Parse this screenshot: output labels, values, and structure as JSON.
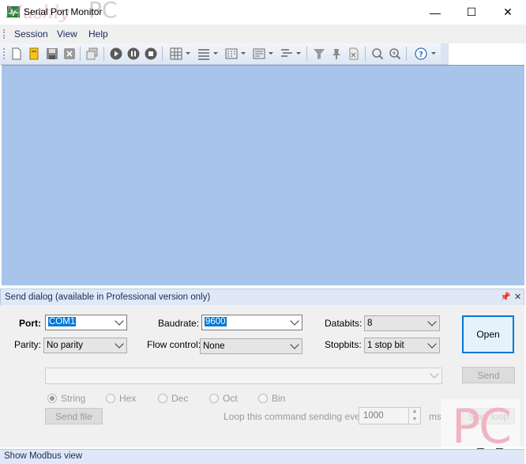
{
  "window": {
    "title": "Serial Port Monitor",
    "controls": {
      "minimize": "—",
      "maximize": "☐",
      "close": "✕"
    }
  },
  "watermark": {
    "script": "Mushly",
    "text": "PC"
  },
  "menu": [
    {
      "label": "Session"
    },
    {
      "label": "View"
    },
    {
      "label": "Help"
    }
  ],
  "toolbar": {
    "icons": [
      "new-session-icon",
      "open-icon",
      "save-icon",
      "close-session-icon",
      "copy-icon",
      "start-icon",
      "pause-icon",
      "stop-icon",
      "grid-view-icon",
      "list-view-icon",
      "dump-view-icon",
      "terminal-view-icon",
      "line-view-icon",
      "filter-icon",
      "pin-icon",
      "clear-icon",
      "find-icon",
      "find-next-icon",
      "help-icon"
    ]
  },
  "send_dialog": {
    "title": "Send dialog (available in Professional version only)",
    "pin_glyph": "📌",
    "close_glyph": "✕",
    "port_label": "Port:",
    "port_value": "COM1",
    "baudrate_label": "Baudrate:",
    "baudrate_value": "9600",
    "databits_label": "Databits:",
    "databits_value": "8",
    "parity_label": "Parity:",
    "parity_value": "No parity",
    "flow_label": "Flow control:",
    "flow_value": "None",
    "stopbits_label": "Stopbits:",
    "stopbits_value": "1 stop bit",
    "open_button": "Open",
    "send_button": "Send",
    "command_value": "",
    "formats": [
      "String",
      "Hex",
      "Dec",
      "Oct",
      "Bin"
    ],
    "send_file_button": "Send file",
    "loop_label": "Loop this command sending every",
    "loop_value": "1000",
    "loop_unit": "ms",
    "start_loop_button": "Start loop"
  },
  "status_bar": {
    "text": "Show Modbus view"
  },
  "colors": {
    "monitor_bg": "#a8c4ea",
    "accent": "#0078d7",
    "panel_header": "#dfe8f6"
  }
}
